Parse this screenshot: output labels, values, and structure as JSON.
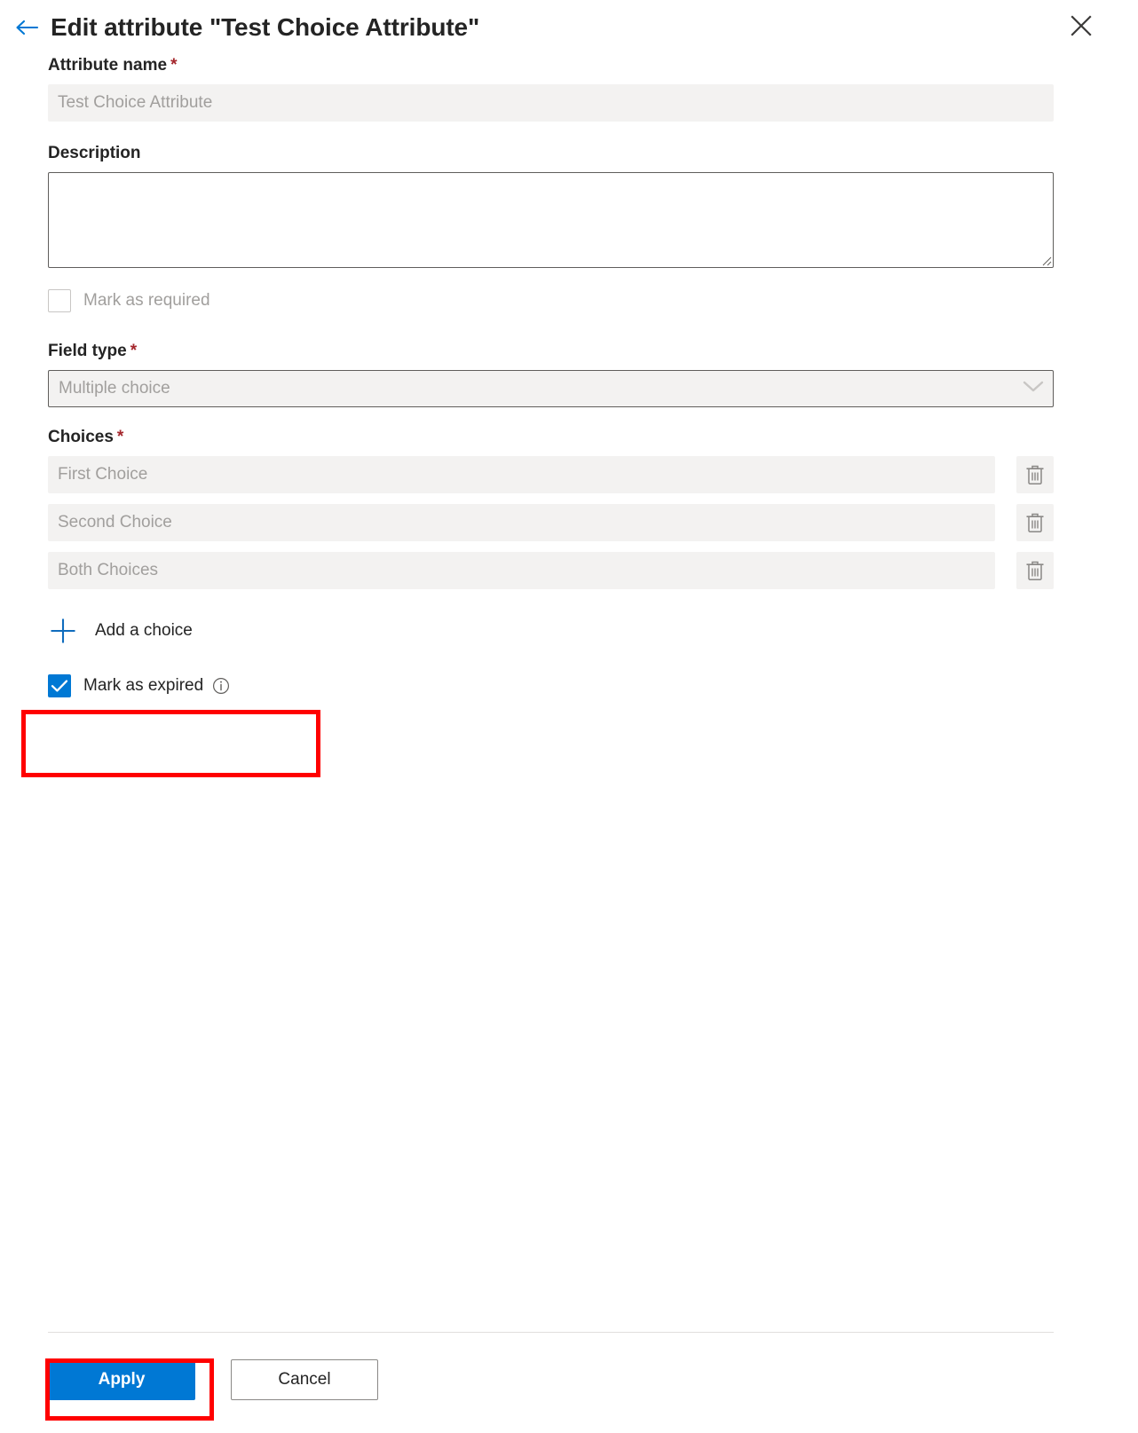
{
  "header": {
    "back_icon": "arrow-left-icon",
    "title": "Edit attribute \"Test Choice Attribute\"",
    "close_icon": "close-icon",
    "accent_color": "#0078d4"
  },
  "form": {
    "attribute_name": {
      "label": "Attribute name",
      "required_marker": "*",
      "value": "",
      "placeholder": "Test Choice Attribute"
    },
    "description": {
      "label": "Description",
      "value": "",
      "placeholder": ""
    },
    "mark_as_required": {
      "label": "Mark as required",
      "checked": false,
      "disabled": true
    },
    "field_type": {
      "label": "Field type",
      "required_marker": "*",
      "value": "Multiple choice",
      "chevron_icon": "chevron-down-icon"
    },
    "choices": {
      "label": "Choices",
      "required_marker": "*",
      "items": [
        {
          "placeholder": "First Choice",
          "value": "",
          "delete_icon": "trash-icon"
        },
        {
          "placeholder": "Second Choice",
          "value": "",
          "delete_icon": "trash-icon"
        },
        {
          "placeholder": "Both Choices",
          "value": "",
          "delete_icon": "trash-icon"
        }
      ]
    },
    "add_choice": {
      "icon": "plus-icon",
      "label": "Add a choice"
    },
    "mark_as_expired": {
      "label": "Mark as expired",
      "checked": true,
      "info_icon": "info-icon"
    }
  },
  "footer": {
    "apply_label": "Apply",
    "cancel_label": "Cancel"
  },
  "annotations": {
    "highlight_color": "#ff0000",
    "boxes": [
      "mark-as-expired-highlight",
      "apply-button-highlight"
    ]
  }
}
